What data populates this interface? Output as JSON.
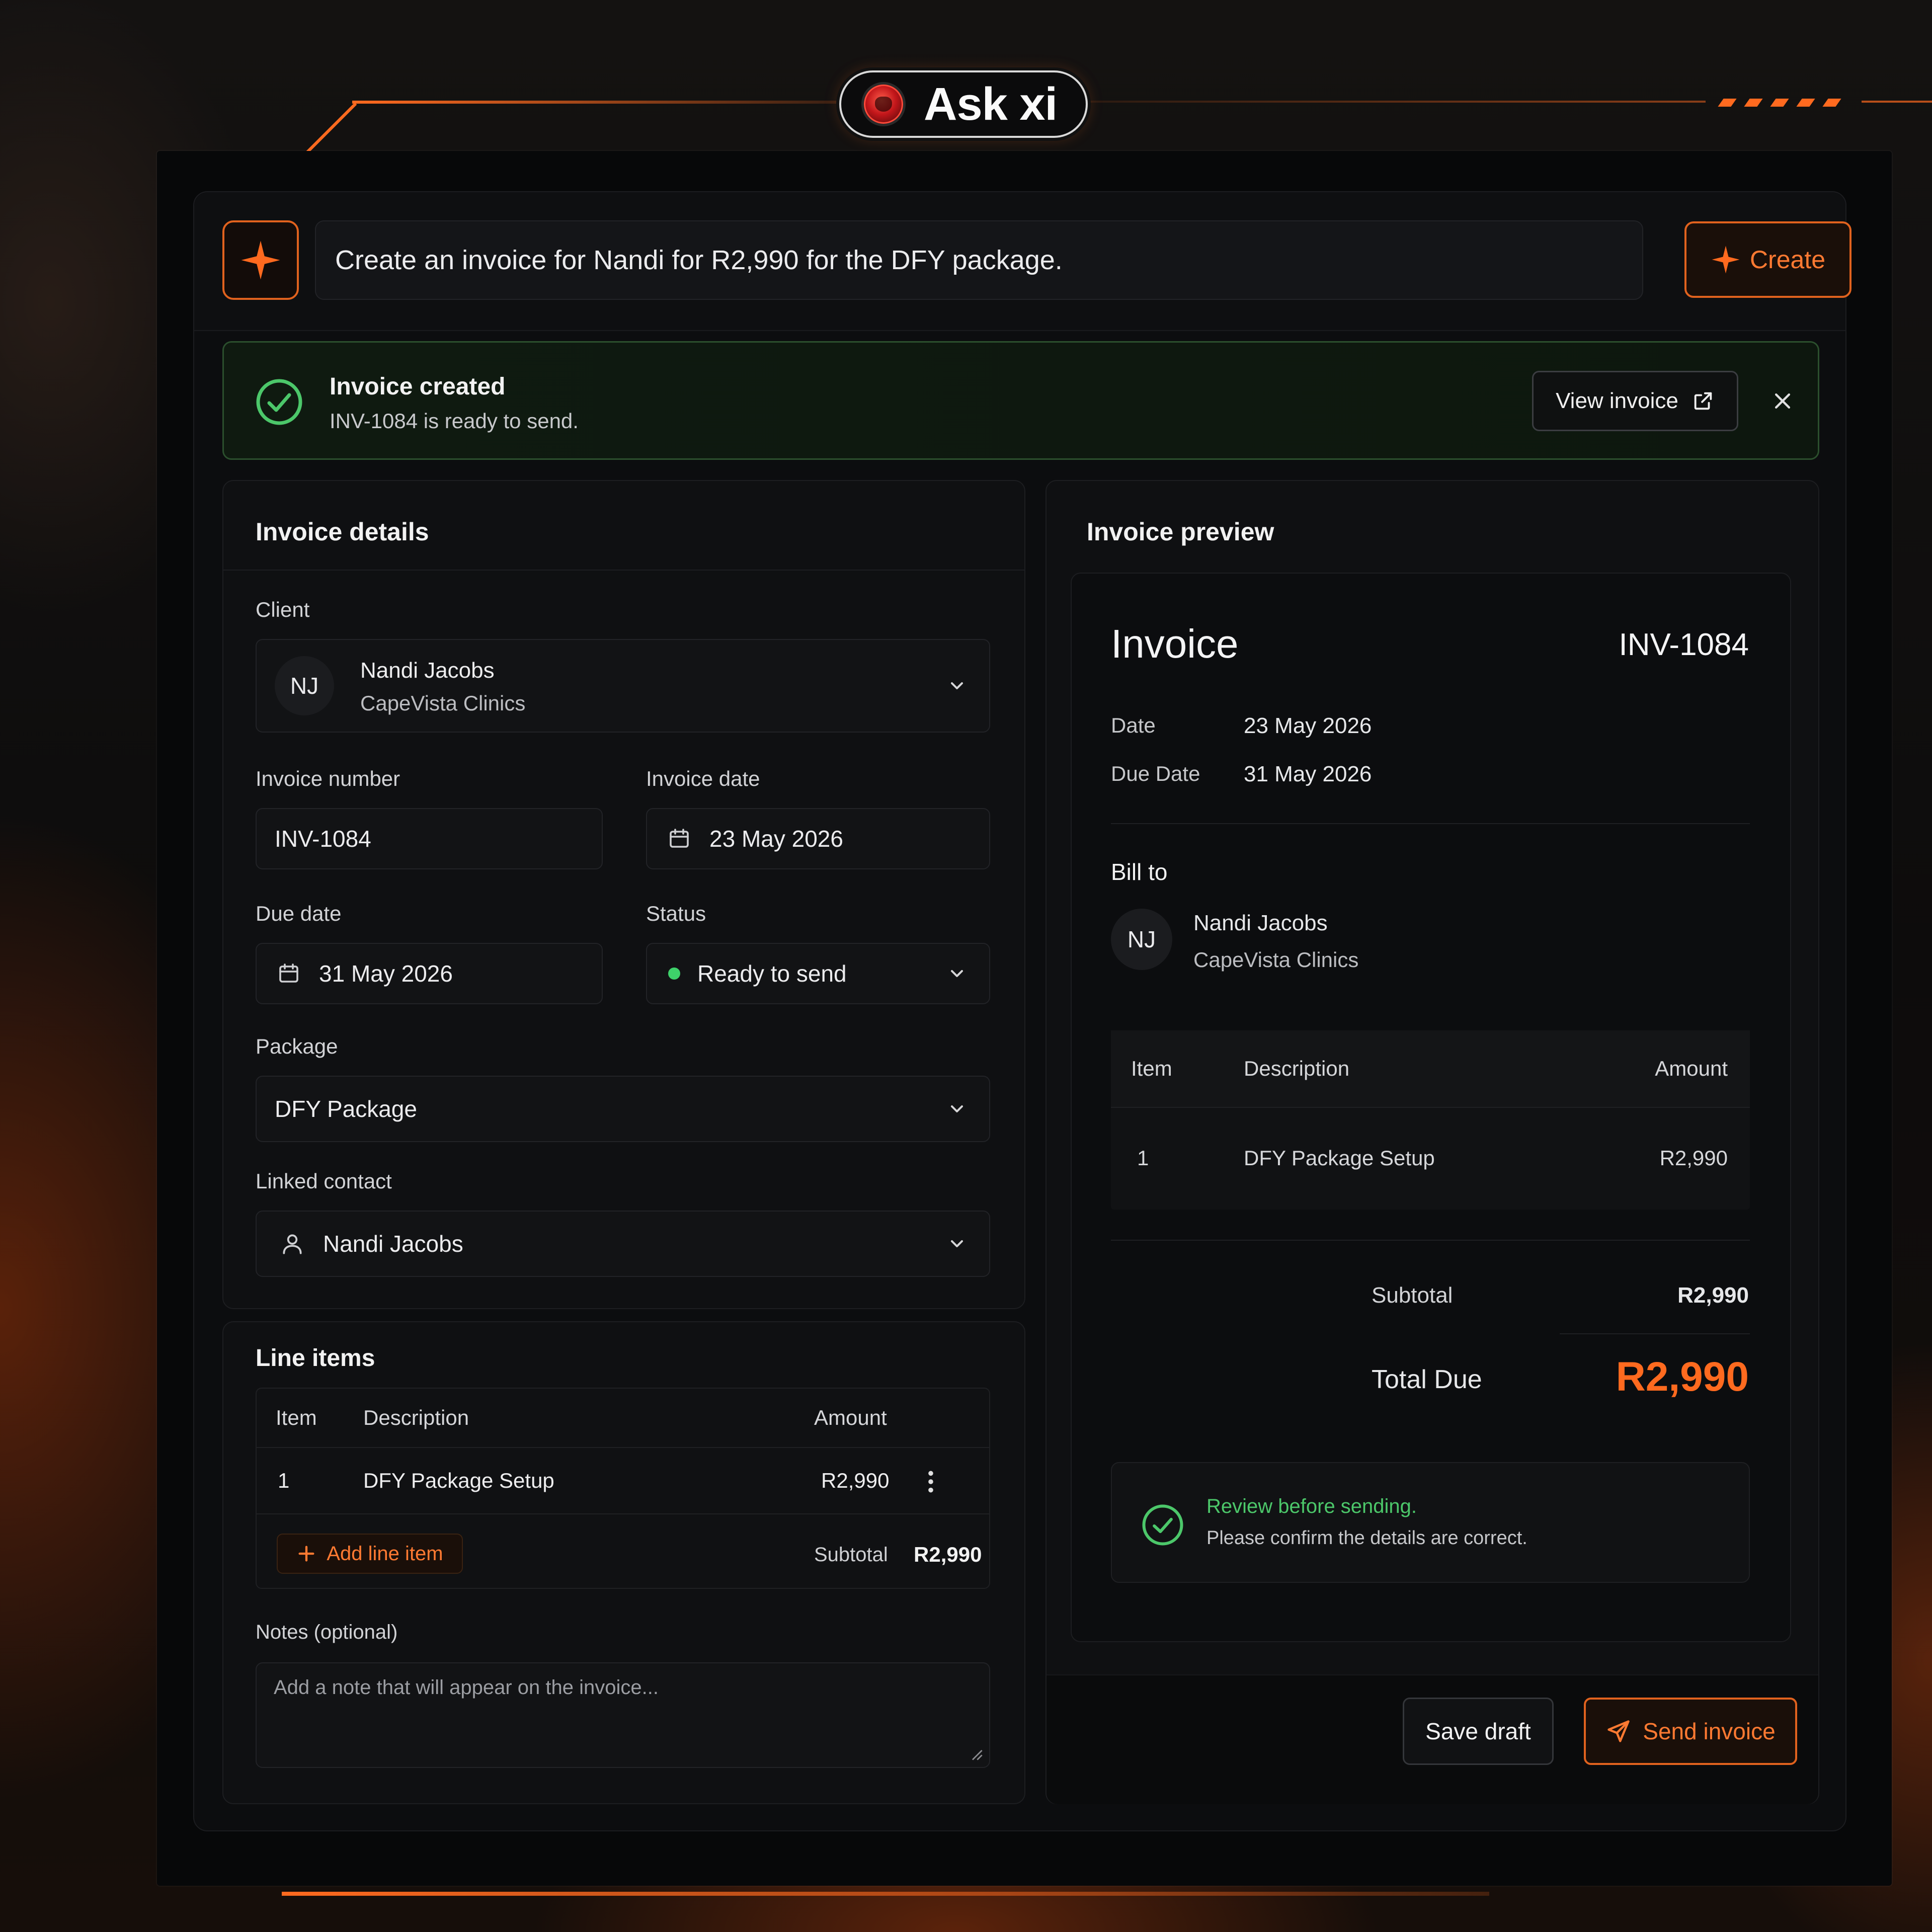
{
  "brand": {
    "name": "Ask xi"
  },
  "colors": {
    "accent": "#ff6a1f",
    "success": "#3ed16a",
    "success_text": "#4cc76a"
  },
  "prompt": {
    "text": "Create an invoice for Nandi for R2,990 for the DFY package.",
    "create_label": "Create",
    "sparkle_icon": "sparkle-icon"
  },
  "banner": {
    "title": "Invoice created",
    "subtitle": "INV-1084 is ready to send.",
    "view_label": "View invoice"
  },
  "details": {
    "title": "Invoice details",
    "client_label": "Client",
    "client": {
      "initials": "NJ",
      "name": "Nandi Jacobs",
      "company": "CapeVista Clinics"
    },
    "invoice_number_label": "Invoice number",
    "invoice_number": "INV-1084",
    "invoice_date_label": "Invoice date",
    "invoice_date": "23 May 2026",
    "due_date_label": "Due date",
    "due_date": "31 May 2026",
    "status_label": "Status",
    "status": "Ready to send",
    "package_label": "Package",
    "package": "DFY Package",
    "linked_contact_label": "Linked contact",
    "linked_contact": "Nandi Jacobs"
  },
  "line_items": {
    "title": "Line items",
    "headers": {
      "item": "Item",
      "description": "Description",
      "amount": "Amount"
    },
    "rows": [
      {
        "item": "1",
        "description": "DFY Package Setup",
        "amount": "R2,990"
      }
    ],
    "add_label": "Add line item",
    "subtotal_label": "Subtotal",
    "subtotal": "R2,990",
    "notes_label": "Notes (optional)",
    "notes_placeholder": "Add a note that will appear on the invoice..."
  },
  "preview": {
    "title": "Invoice preview",
    "heading": "Invoice",
    "number": "INV-1084",
    "date_label": "Date",
    "date": "23 May 2026",
    "due_label": "Due Date",
    "due": "31 May 2026",
    "bill_to_label": "Bill to",
    "client": {
      "initials": "NJ",
      "name": "Nandi Jacobs",
      "company": "CapeVista Clinics"
    },
    "headers": {
      "item": "Item",
      "description": "Description",
      "amount": "Amount"
    },
    "rows": [
      {
        "item": "1",
        "description": "DFY Package Setup",
        "amount": "R2,990"
      }
    ],
    "subtotal_label": "Subtotal",
    "subtotal": "R2,990",
    "total_label": "Total Due",
    "total": "R2,990",
    "review_title": "Review before sending.",
    "review_sub": "Please confirm the details are correct."
  },
  "actions": {
    "save_label": "Save draft",
    "send_label": "Send invoice"
  }
}
